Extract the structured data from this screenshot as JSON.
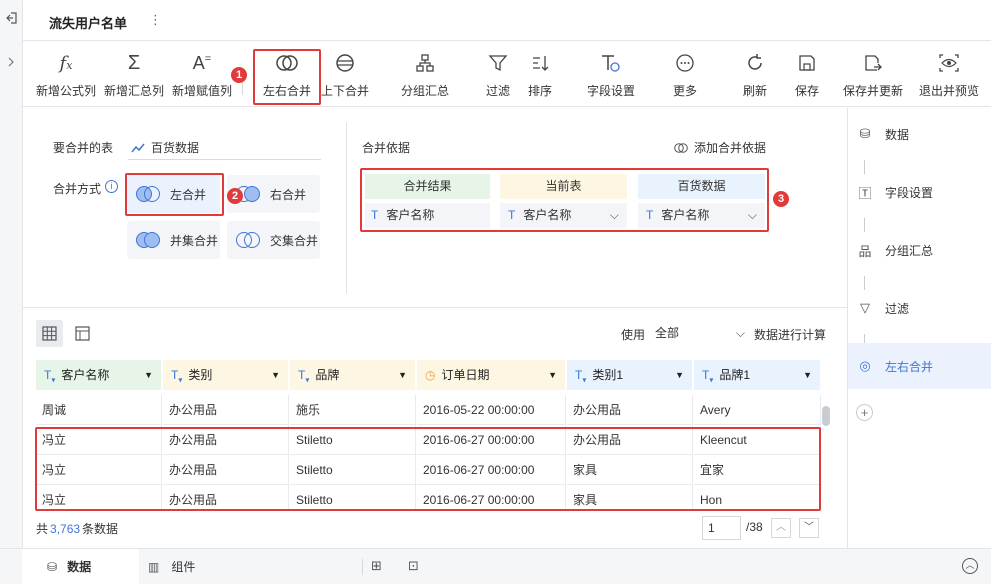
{
  "app": {
    "title": "流失用户名单",
    "more": "⋮"
  },
  "toolbar": {
    "items": [
      {
        "label": "新增公式列",
        "icon": "fx-icon"
      },
      {
        "label": "新增汇总列",
        "icon": "sigma-icon"
      },
      {
        "label": "新增赋值列",
        "icon": "assign-icon"
      },
      {
        "label": "左右合并",
        "icon": "venn-merge-icon"
      },
      {
        "label": "上下合并",
        "icon": "stack-merge-icon"
      },
      {
        "label": "分组汇总",
        "icon": "group-icon"
      },
      {
        "label": "过滤",
        "icon": "filter-icon"
      },
      {
        "label": "排序",
        "icon": "sort-icon"
      },
      {
        "label": "字段设置",
        "icon": "field-settings-icon"
      },
      {
        "label": "更多",
        "icon": "more-icon"
      },
      {
        "label": "刷新",
        "icon": "refresh-icon"
      },
      {
        "label": "保存",
        "icon": "save-icon"
      },
      {
        "label": "保存并更新",
        "icon": "save-update-icon"
      },
      {
        "label": "退出并预览",
        "icon": "preview-icon"
      }
    ]
  },
  "badges": {
    "b1": "1",
    "b2": "2",
    "b3": "3"
  },
  "merge": {
    "table_label": "要合并的表",
    "table_value": "百货数据",
    "method_label": "合并方式",
    "methods": [
      "左合并",
      "右合并",
      "并集合并",
      "交集合并"
    ],
    "basis_label": "合并依据",
    "add_basis": "添加合并依据",
    "headers": [
      "合并结果",
      "当前表",
      "百货数据"
    ],
    "cells": [
      "客户名称",
      "客户名称",
      "客户名称"
    ]
  },
  "grid": {
    "use_label": "使用",
    "scope": "全部",
    "calc_label": "数据进行计算",
    "columns": [
      "客户名称",
      "类别",
      "品牌",
      "订单日期",
      "类别1",
      "品牌1"
    ],
    "rows": [
      [
        "周诚",
        "办公用品",
        "施乐",
        "2016-05-22 00:00:00",
        "办公用品",
        "Avery"
      ],
      [
        "冯立",
        "办公用品",
        "Stiletto",
        "2016-06-27 00:00:00",
        "办公用品",
        "Kleencut"
      ],
      [
        "冯立",
        "办公用品",
        "Stiletto",
        "2016-06-27 00:00:00",
        "家具",
        "宜家"
      ],
      [
        "冯立",
        "办公用品",
        "Stiletto",
        "2016-06-27 00:00:00",
        "家具",
        "Hon"
      ]
    ],
    "total_prefix": "共",
    "total": "3,763",
    "total_suffix": "条数据",
    "page": "1",
    "page_total": "/38"
  },
  "rpanel": {
    "items": [
      "数据",
      "字段设置",
      "分组汇总",
      "过滤",
      "左右合并"
    ]
  },
  "bottom": {
    "tab_data": "数据",
    "tab_component": "组件"
  },
  "colors": {
    "accent": "#3e76d6",
    "red": "#e03a3a",
    "active_bg": "#ebf2fd"
  }
}
